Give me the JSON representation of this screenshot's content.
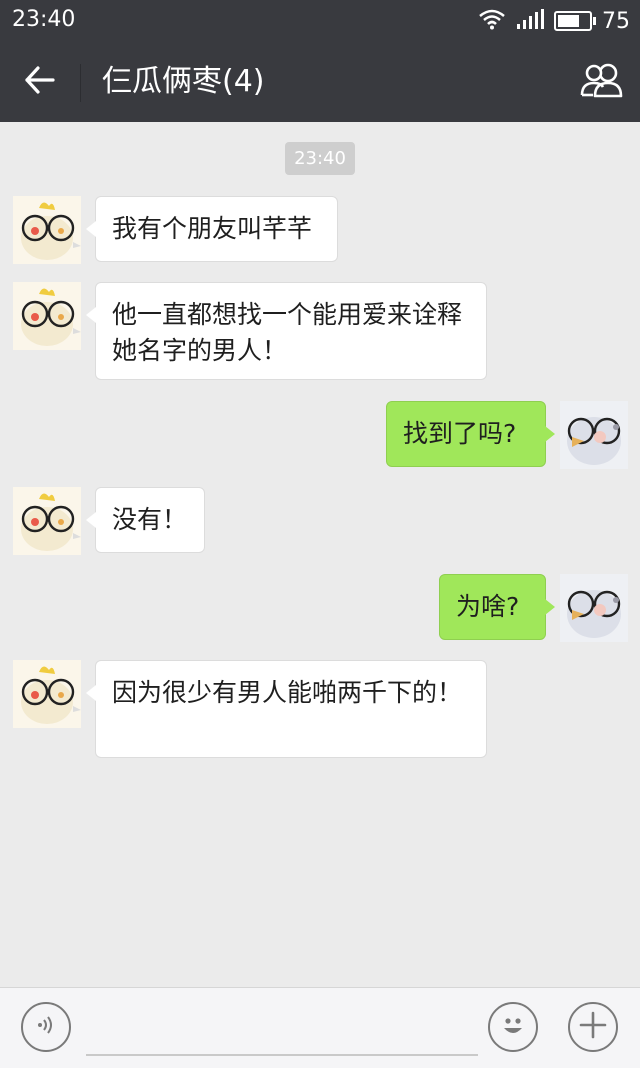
{
  "status_bar": {
    "time": "23:40",
    "battery": "75",
    "battery_level": 0.75,
    "icons": [
      "wifi-icon",
      "signal-icon",
      "battery-icon"
    ]
  },
  "header": {
    "title": "仨瓜俩枣(4)",
    "back_icon": "back-arrow-icon",
    "members_icon": "group-members-icon"
  },
  "chat": {
    "timestamp": "23:40",
    "messages": [
      {
        "side": "incoming",
        "text": "我有个朋友叫芊芊"
      },
      {
        "side": "incoming",
        "text": "他一直都想找一个能用爱来诠释她名字的男人！"
      },
      {
        "side": "outgoing",
        "text": "找到了吗?"
      },
      {
        "side": "incoming",
        "text": "没有！"
      },
      {
        "side": "outgoing",
        "text": "为啥?"
      },
      {
        "side": "incoming",
        "text": "因为很少有男人能啪两千下的！"
      }
    ]
  },
  "input_bar": {
    "voice_icon": "voice-icon",
    "emoji_icon": "emoji-icon",
    "add_icon": "plus-icon",
    "input_value": ""
  },
  "colors": {
    "header_bg": "#393a3f",
    "chat_bg": "#ebebeb",
    "outgoing_bubble": "#a0e75a",
    "incoming_bubble": "#ffffff"
  }
}
